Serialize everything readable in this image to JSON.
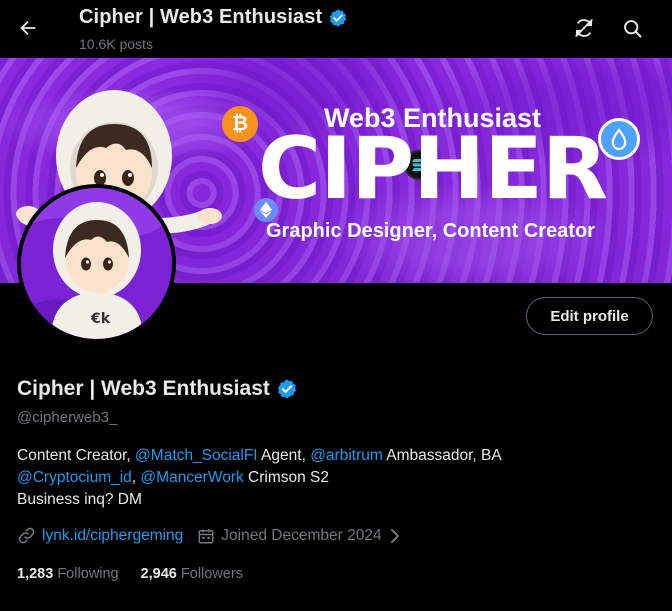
{
  "header": {
    "title": "Cipher | Web3 Enthusiast",
    "posts_count": "10.6K posts",
    "icons": [
      "back-arrow-icon",
      "verified-badge-icon",
      "no-sync-icon",
      "search-icon"
    ]
  },
  "banner": {
    "tagline": "Web3 Enthusiast",
    "brand": "CIPHER",
    "subtitle": "Graphic Designer, Content Creator"
  },
  "actions": {
    "edit_profile_label": "Edit profile"
  },
  "profile": {
    "display_name": "Cipher | Web3 Enthusiast",
    "handle": "@cipherweb3_",
    "bio": {
      "line1_a": "Content Creator, ",
      "mention1": "@Match_SocialFI",
      "line1_b": " Agent, ",
      "mention2": "@arbitrum",
      "line1_c": " Ambassador, BA",
      "mention3": "@Cryptocium_id",
      "line2_a": ", ",
      "mention4": "@MancerWork",
      "line2_b": " Crimson S2",
      "line3": "Business inq? DM"
    },
    "website": "lynk.id/ciphergeming",
    "joined": "Joined December 2024",
    "following_count": "1,283",
    "following_label": "Following",
    "followers_count": "2,946",
    "followers_label": "Followers"
  },
  "colors": {
    "background": "#000000",
    "text_primary": "#e7e9ea",
    "text_secondary": "#71767b",
    "accent_blue": "#1d9bf0",
    "banner_purple": "#8a2be2"
  }
}
